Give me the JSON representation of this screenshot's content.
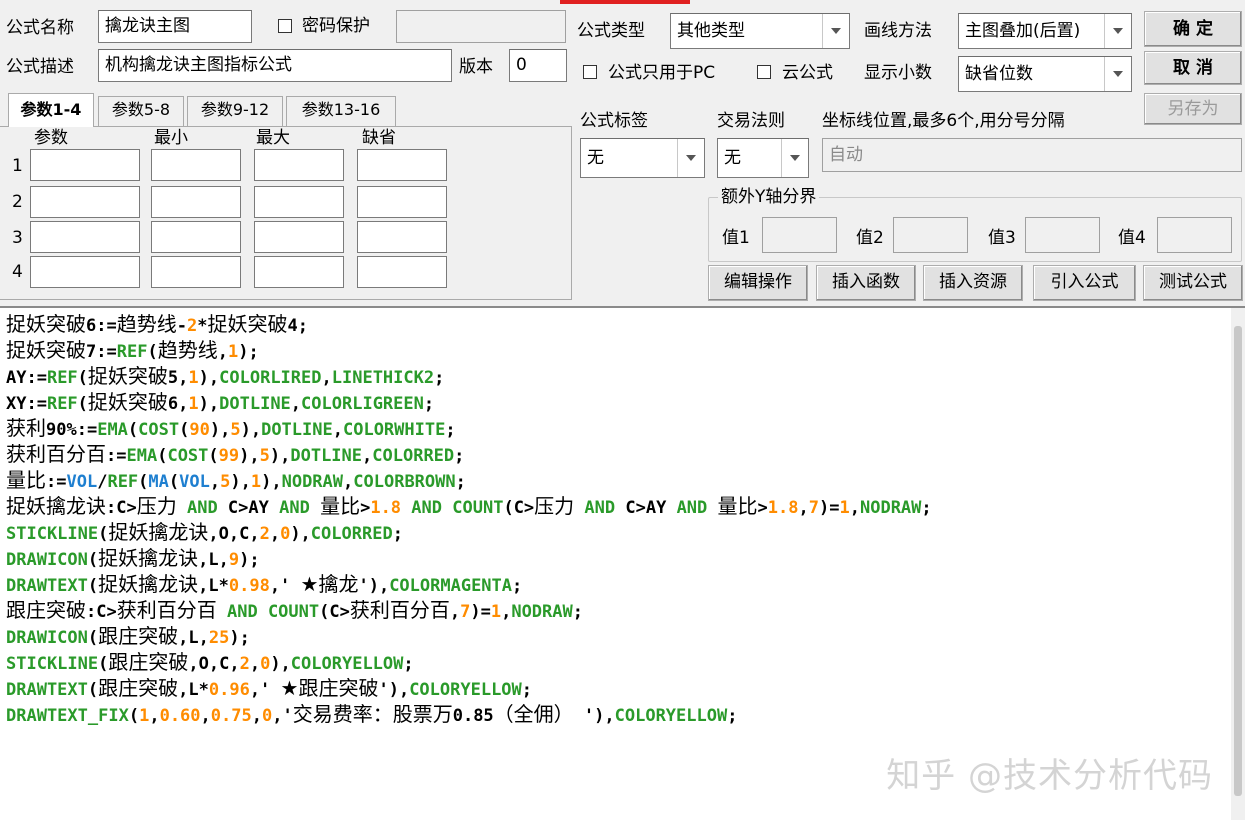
{
  "header": {
    "name_label": "公式名称",
    "name_value": "擒龙诀主图",
    "password_label": "密码保护",
    "password_checked": false,
    "desc_label": "公式描述",
    "desc_value": "机构擒龙诀主图指标公式",
    "version_label": "版本",
    "version_value": "0",
    "type_label": "公式类型",
    "type_value": "其他类型",
    "draw_method_label": "画线方法",
    "draw_method_value": "主图叠加(后置)",
    "pc_only_label": "公式只用于PC",
    "pc_only_checked": false,
    "cloud_label": "云公式",
    "cloud_checked": false,
    "decimals_label": "显示小数",
    "decimals_value": "缺省位数"
  },
  "buttons": {
    "ok": "确 定",
    "cancel": "取 消",
    "save_as": "另存为",
    "edit_ops": "编辑操作",
    "insert_func": "插入函数",
    "insert_res": "插入资源",
    "import_formula": "引入公式",
    "test_formula": "测试公式"
  },
  "params": {
    "tabs": [
      "参数1-4",
      "参数5-8",
      "参数9-12",
      "参数13-16"
    ],
    "active_tab": 0,
    "columns": [
      "参数",
      "最小",
      "最大",
      "缺省"
    ],
    "rows": [
      "1",
      "2",
      "3",
      "4"
    ]
  },
  "tags": {
    "label": "公式标签",
    "value": "无",
    "trade_rule_label": "交易法则",
    "trade_rule_value": "无",
    "coord_label": "坐标线位置,最多6个,用分号分隔",
    "coord_placeholder": "自动"
  },
  "yaxis": {
    "title": "额外Y轴分界",
    "labels": [
      "值1",
      "值2",
      "值3",
      "值4"
    ]
  },
  "code_lines": [
    [
      [
        "t",
        "捉妖突破6"
      ],
      [
        "o",
        ":=趋势线-"
      ],
      [
        "n",
        "2"
      ],
      [
        "o",
        "*捉妖突破4;"
      ]
    ],
    [
      [
        "t",
        "捉妖突破7"
      ],
      [
        "o",
        ":="
      ],
      [
        "f",
        "REF"
      ],
      [
        "o",
        "(趋势线,"
      ],
      [
        "n",
        "1"
      ],
      [
        "o",
        ");"
      ]
    ],
    [
      [
        "o",
        "AY:="
      ],
      [
        "f",
        "REF"
      ],
      [
        "o",
        "(捉妖突破5,"
      ],
      [
        "n",
        "1"
      ],
      [
        "o",
        "),"
      ],
      [
        "k",
        "COLORLIRED"
      ],
      [
        "o",
        ","
      ],
      [
        "k",
        "LINETHICK2"
      ],
      [
        "o",
        ";"
      ]
    ],
    [
      [
        "o",
        "XY:="
      ],
      [
        "f",
        "REF"
      ],
      [
        "o",
        "(捉妖突破6,"
      ],
      [
        "n",
        "1"
      ],
      [
        "o",
        "),"
      ],
      [
        "k",
        "DOTLINE"
      ],
      [
        "o",
        ","
      ],
      [
        "k",
        "COLORLIGREEN"
      ],
      [
        "o",
        ";"
      ]
    ],
    [
      [
        "t",
        "获利90%"
      ],
      [
        "o",
        ":="
      ],
      [
        "f",
        "EMA"
      ],
      [
        "o",
        "("
      ],
      [
        "f",
        "COST"
      ],
      [
        "o",
        "("
      ],
      [
        "n",
        "90"
      ],
      [
        "o",
        "),"
      ],
      [
        "n",
        "5"
      ],
      [
        "o",
        "),"
      ],
      [
        "k",
        "DOTLINE"
      ],
      [
        "o",
        ","
      ],
      [
        "k",
        "COLORWHITE"
      ],
      [
        "o",
        ";"
      ]
    ],
    [
      [
        "t",
        "获利百分百"
      ],
      [
        "o",
        ":="
      ],
      [
        "f",
        "EMA"
      ],
      [
        "o",
        "("
      ],
      [
        "f",
        "COST"
      ],
      [
        "o",
        "("
      ],
      [
        "n",
        "99"
      ],
      [
        "o",
        "),"
      ],
      [
        "n",
        "5"
      ],
      [
        "o",
        "),"
      ],
      [
        "k",
        "DOTLINE"
      ],
      [
        "o",
        ","
      ],
      [
        "k",
        "COLORRED"
      ],
      [
        "o",
        ";"
      ]
    ],
    [
      [
        "t",
        "量比"
      ],
      [
        "o",
        ":="
      ],
      [
        "v",
        "VOL"
      ],
      [
        "o",
        "/"
      ],
      [
        "f",
        "REF"
      ],
      [
        "o",
        "("
      ],
      [
        "v",
        "MA"
      ],
      [
        "o",
        "("
      ],
      [
        "v",
        "VOL"
      ],
      [
        "o",
        ","
      ],
      [
        "n",
        "5"
      ],
      [
        "o",
        "),"
      ],
      [
        "n",
        "1"
      ],
      [
        "o",
        "),"
      ],
      [
        "k",
        "NODRAW"
      ],
      [
        "o",
        ","
      ],
      [
        "k",
        "COLORBROWN"
      ],
      [
        "o",
        ";"
      ]
    ],
    [
      [
        "t",
        "捉妖擒龙诀"
      ],
      [
        "o",
        ":C>压力 "
      ],
      [
        "k",
        "AND"
      ],
      [
        "o",
        " C>AY "
      ],
      [
        "k",
        "AND"
      ],
      [
        "o",
        " 量比>"
      ],
      [
        "n",
        "1.8"
      ],
      [
        "o",
        " "
      ],
      [
        "k",
        "AND"
      ],
      [
        "o",
        " "
      ],
      [
        "f",
        "COUNT"
      ],
      [
        "o",
        "(C>压力 "
      ],
      [
        "k",
        "AND"
      ],
      [
        "o",
        " C>AY "
      ],
      [
        "k",
        "AND"
      ],
      [
        "o",
        " 量比>"
      ],
      [
        "n",
        "1.8"
      ],
      [
        "o",
        ","
      ],
      [
        "n",
        "7"
      ],
      [
        "o",
        ")="
      ],
      [
        "n",
        "1"
      ],
      [
        "o",
        ","
      ],
      [
        "k",
        "NODRAW"
      ],
      [
        "o",
        ";"
      ]
    ],
    [
      [
        "f",
        "STICKLINE"
      ],
      [
        "o",
        "(捉妖擒龙诀,O,C,"
      ],
      [
        "n",
        "2"
      ],
      [
        "o",
        ","
      ],
      [
        "n",
        "0"
      ],
      [
        "o",
        "),"
      ],
      [
        "k",
        "COLORRED"
      ],
      [
        "o",
        ";"
      ]
    ],
    [
      [
        "f",
        "DRAWICON"
      ],
      [
        "o",
        "(捉妖擒龙诀,L,"
      ],
      [
        "n",
        "9"
      ],
      [
        "o",
        ");"
      ]
    ],
    [
      [
        "f",
        "DRAWTEXT"
      ],
      [
        "o",
        "(捉妖擒龙诀,L*"
      ],
      [
        "n",
        "0.98"
      ],
      [
        "o",
        ",' ★擒龙'),"
      ],
      [
        "k",
        "COLORMAGENTA"
      ],
      [
        "o",
        ";"
      ]
    ],
    [
      [
        "t",
        "跟庄突破"
      ],
      [
        "o",
        ":C>获利百分百 "
      ],
      [
        "k",
        "AND"
      ],
      [
        "o",
        " "
      ],
      [
        "f",
        "COUNT"
      ],
      [
        "o",
        "(C>获利百分百,"
      ],
      [
        "n",
        "7"
      ],
      [
        "o",
        ")="
      ],
      [
        "n",
        "1"
      ],
      [
        "o",
        ","
      ],
      [
        "k",
        "NODRAW"
      ],
      [
        "o",
        ";"
      ]
    ],
    [
      [
        "f",
        "DRAWICON"
      ],
      [
        "o",
        "(跟庄突破,L,"
      ],
      [
        "n",
        "25"
      ],
      [
        "o",
        ");"
      ]
    ],
    [
      [
        "f",
        "STICKLINE"
      ],
      [
        "o",
        "(跟庄突破,O,C,"
      ],
      [
        "n",
        "2"
      ],
      [
        "o",
        ","
      ],
      [
        "n",
        "0"
      ],
      [
        "o",
        "),"
      ],
      [
        "k",
        "COLORYELLOW"
      ],
      [
        "o",
        ";"
      ]
    ],
    [
      [
        "f",
        "DRAWTEXT"
      ],
      [
        "o",
        "(跟庄突破,L*"
      ],
      [
        "n",
        "0.96"
      ],
      [
        "o",
        ",' ★跟庄突破'),"
      ],
      [
        "k",
        "COLORYELLOW"
      ],
      [
        "o",
        ";"
      ]
    ],
    [
      [
        "f",
        "DRAWTEXT_FIX"
      ],
      [
        "o",
        "("
      ],
      [
        "n",
        "1"
      ],
      [
        "o",
        ","
      ],
      [
        "n",
        "0.60"
      ],
      [
        "o",
        ","
      ],
      [
        "n",
        "0.75"
      ],
      [
        "o",
        ","
      ],
      [
        "n",
        "0"
      ],
      [
        "o",
        ",'交易费率：股票万0.85（全佣） '),"
      ],
      [
        "k",
        "COLORYELLOW"
      ],
      [
        "o",
        ";"
      ]
    ]
  ],
  "watermark": "知乎 @技术分析代码",
  "colors": {
    "keyword": "#2a9a2a",
    "number": "#ff8c00",
    "variable": "#1e7fd0",
    "text": "#000000"
  }
}
